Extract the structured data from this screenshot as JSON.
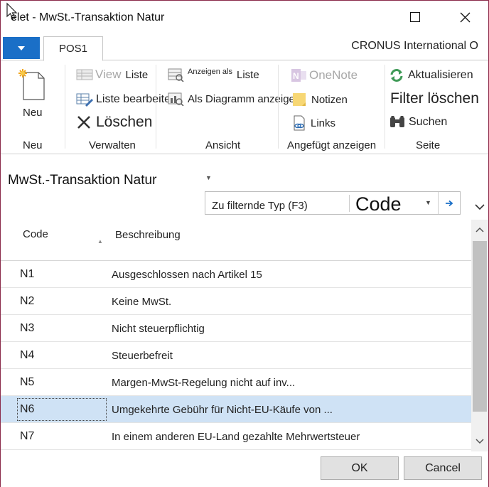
{
  "window": {
    "title": "elet - MwSt.-Transaktion  Natur",
    "company": "CRONUS International O"
  },
  "tabs": [
    {
      "label": "POS1"
    }
  ],
  "ribbon": {
    "new": {
      "label": "Neu",
      "group": "Neu"
    },
    "manage": {
      "group": "Verwalten",
      "view_label": "View",
      "view_suffix": "Liste",
      "edit_list": "Liste bearbeiten",
      "delete": "Löschen"
    },
    "view": {
      "group": "Ansicht",
      "show_as_prefix": "Anzeigen als",
      "show_as_list": "Liste",
      "show_as_chart": "Als Diagramm anzeigen"
    },
    "attached": {
      "group": "Angefügt anzeigen",
      "onenote": "OneNote",
      "notes": "Notizen",
      "links": "Links"
    },
    "page": {
      "group": "Seite",
      "refresh": "Aktualisieren",
      "clear_filter": "Filter löschen",
      "search": "Suchen"
    }
  },
  "page": {
    "title": "MwSt.-Transaktion  Natur",
    "filter_label": "Zu filternde Typ (F3)",
    "filter_field": "Code"
  },
  "list": {
    "columns": {
      "code": "Code",
      "description": "Beschreibung"
    },
    "rows": [
      {
        "code": "N1",
        "description": "Ausgeschlossen nach Artikel 15"
      },
      {
        "code": "N2",
        "description": "Keine MwSt."
      },
      {
        "code": "N3",
        "description": "Nicht steuerpflichtig"
      },
      {
        "code": "N4",
        "description": "Steuerbefreit"
      },
      {
        "code": "N5",
        "description": "Margen-MwSt-Regelung nicht auf inv..."
      },
      {
        "code": "N6",
        "description": "Umgekehrte Gebühr für Nicht-EU-Käufe von ..."
      },
      {
        "code": "N7",
        "description": "In einem anderen EU-Land gezahlte Mehrwertsteuer"
      }
    ],
    "selected_index": 5
  },
  "footer": {
    "ok": "OK",
    "cancel": "Cancel"
  },
  "colors": {
    "accent": "#1a6fc7",
    "selection": "#cfe2f5",
    "border": "#8a2a4a"
  }
}
